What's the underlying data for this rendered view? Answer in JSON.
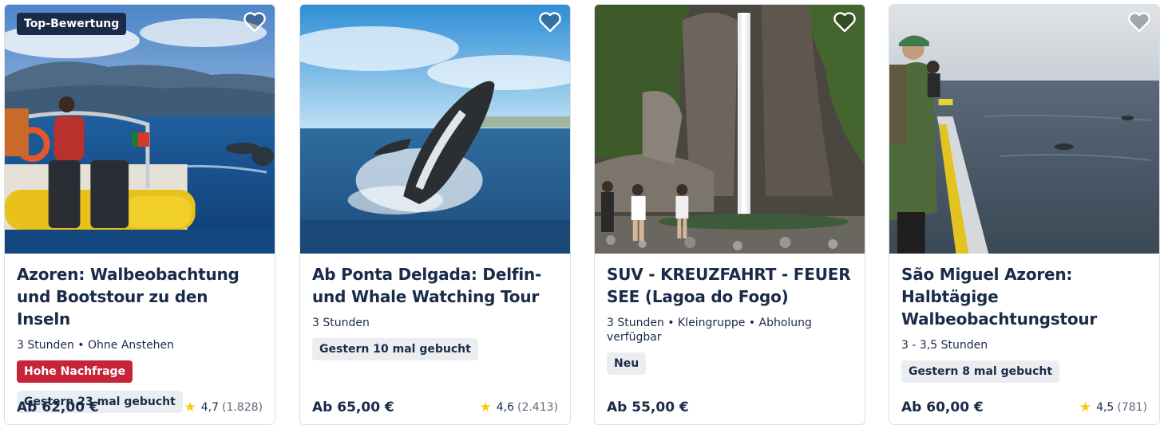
{
  "cards": [
    {
      "badge": "Top-Bewertung",
      "title": "Azoren: Walbeobachtung und Bootstour zu den Inseln",
      "meta": "3 Stunden • Ohne Anstehen",
      "tags": [
        "Hohe Nachfrage",
        "Gestern 23 mal gebucht"
      ],
      "price": "Ab 62,00 €",
      "rating": "4,7",
      "reviews": "(1.828)",
      "image_icon": "boat-whale-photo"
    },
    {
      "title": "Ab Ponta Delgada: Delfin- und Whale Watching Tour",
      "meta": "3 Stunden",
      "tags": [
        "Gestern 10 mal gebucht"
      ],
      "price": "Ab 65,00 €",
      "rating": "4,6",
      "reviews": "(2.413)",
      "image_icon": "breaching-whale-photo"
    },
    {
      "title": "SUV - KREUZFAHRT - FEUER SEE (Lagoa do Fogo)",
      "meta": "3 Stunden • Kleingruppe • Abholung verfügbar",
      "tags": [
        "Neu"
      ],
      "price": "Ab 55,00 €",
      "image_icon": "waterfall-photo"
    },
    {
      "title": "São Miguel Azoren: Halbtägige Walbeobachtungstour",
      "meta": "3 - 3,5 Stunden",
      "tags": [
        "Gestern 8 mal gebucht"
      ],
      "price": "Ab 60,00 €",
      "rating": "4,5",
      "reviews": "(781)",
      "image_icon": "ship-deck-photo"
    }
  ],
  "colors": {
    "navy": "#1a2b49",
    "high_demand": "#c7243a",
    "tag_grey": "#ebeef1",
    "star": "#fdc812"
  },
  "icons": {
    "favorite": "heart-icon",
    "rating": "star-icon"
  }
}
